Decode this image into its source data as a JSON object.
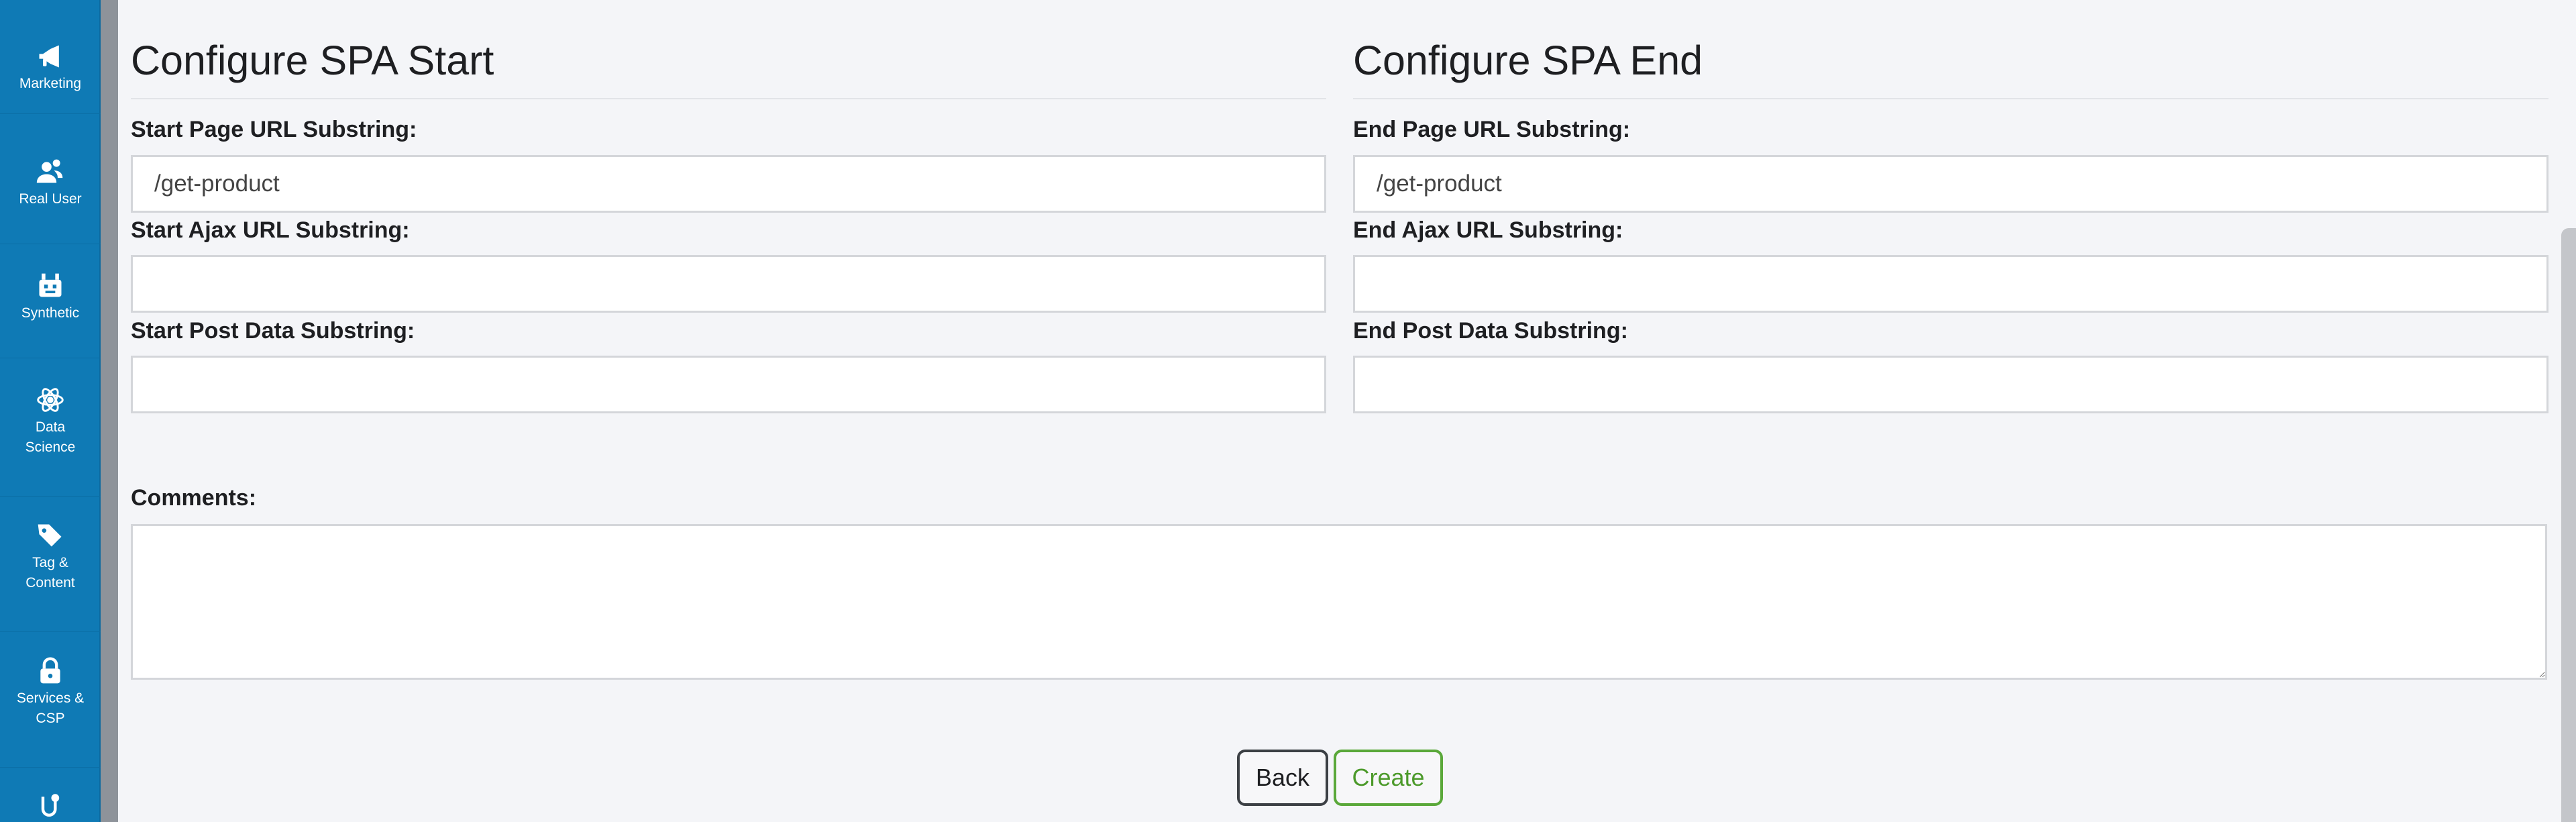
{
  "sidebar": {
    "items": [
      {
        "label": "Marketing",
        "icon": "megaphone-icon"
      },
      {
        "label": "Real User",
        "icon": "users-icon"
      },
      {
        "label": "Synthetic",
        "icon": "robot-icon"
      },
      {
        "label": "Data\nScience",
        "icon": "atom-icon"
      },
      {
        "label": "Tag &\nContent",
        "icon": "tags-icon"
      },
      {
        "label": "Services &\nCSP",
        "icon": "lock-icon"
      },
      {
        "label": "",
        "icon": "path-icon"
      }
    ],
    "background": "#0f7ab5"
  },
  "start": {
    "heading": "Configure SPA Start",
    "page_url_label": "Start Page URL Substring:",
    "page_url_value": "/get-product",
    "ajax_url_label": "Start Ajax URL Substring:",
    "ajax_url_value": "",
    "post_data_label": "Start Post Data Substring:",
    "post_data_value": ""
  },
  "end": {
    "heading": "Configure SPA End",
    "page_url_label": "End Page URL Substring:",
    "page_url_value": "/get-product",
    "ajax_url_label": "End Ajax URL Substring:",
    "ajax_url_value": "",
    "post_data_label": "End Post Data Substring:",
    "post_data_value": ""
  },
  "comments": {
    "label": "Comments:",
    "value": ""
  },
  "buttons": {
    "back": "Back",
    "create": "Create",
    "create_color": "#4c9a2b"
  }
}
